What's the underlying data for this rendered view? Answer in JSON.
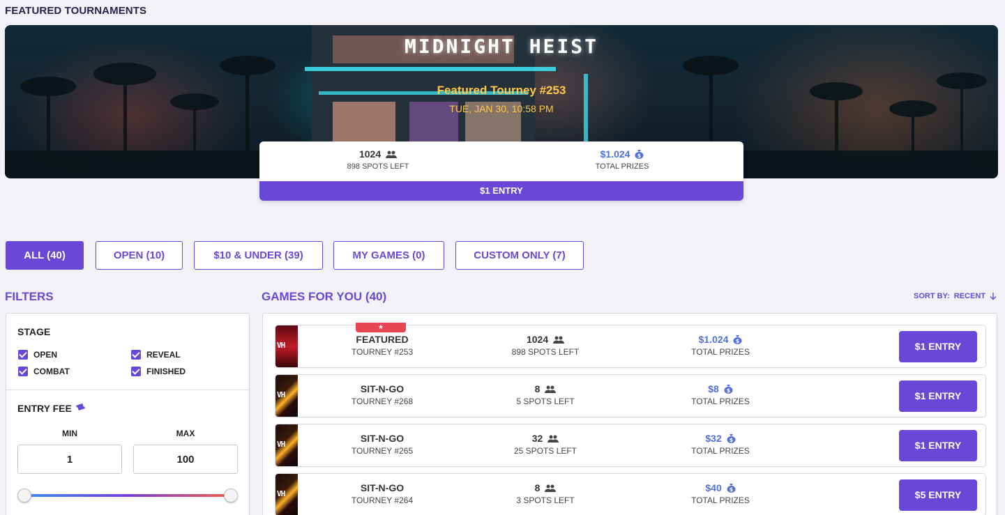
{
  "section_title": "FEATURED TOURNAMENTS",
  "banner": {
    "logo_text": "MIDNIGHT HEIST",
    "title": "Featured Tourney #253",
    "date": "TUE, JAN 30, 10:58 PM",
    "players": "1024",
    "spots_left": "898 SPOTS LEFT",
    "prize": "$1.024",
    "prize_label": "TOTAL PRIZES",
    "entry": "$1 ENTRY"
  },
  "tabs": [
    {
      "label": "ALL (40)",
      "active": true
    },
    {
      "label": "OPEN (10)"
    },
    {
      "label": "$10 & UNDER (39)"
    },
    {
      "label": "MY GAMES (0)"
    },
    {
      "label": "CUSTOM ONLY (7)"
    }
  ],
  "filters": {
    "title": "FILTERS",
    "stage_title": "STAGE",
    "stages": [
      "OPEN",
      "REVEAL",
      "COMBAT",
      "FINISHED"
    ],
    "fee_title": "ENTRY FEE",
    "min_label": "MIN",
    "max_label": "MAX",
    "min_value": "1",
    "max_value": "100"
  },
  "games": {
    "title": "GAMES FOR YOU (40)",
    "sort_label": "SORT BY:",
    "sort_value": "RECENT",
    "thumb_text": "VH",
    "rows": [
      {
        "type": "FEATURED",
        "tourney": "TOURNEY #253",
        "players": "1024",
        "spots": "898 SPOTS LEFT",
        "prize": "$1.024",
        "prize_label": "TOTAL PRIZES",
        "entry": "$1 ENTRY",
        "featured": true
      },
      {
        "type": "SIT-N-GO",
        "tourney": "TOURNEY #268",
        "players": "8",
        "spots": "5 SPOTS LEFT",
        "prize": "$8",
        "prize_label": "TOTAL PRIZES",
        "entry": "$1 ENTRY"
      },
      {
        "type": "SIT-N-GO",
        "tourney": "TOURNEY #265",
        "players": "32",
        "spots": "25 SPOTS LEFT",
        "prize": "$32",
        "prize_label": "TOTAL PRIZES",
        "entry": "$1 ENTRY"
      },
      {
        "type": "SIT-N-GO",
        "tourney": "TOURNEY #264",
        "players": "8",
        "spots": "3 SPOTS LEFT",
        "prize": "$40",
        "prize_label": "TOTAL PRIZES",
        "entry": "$5 ENTRY"
      }
    ]
  },
  "colors": {
    "accent": "#6a48d7",
    "prize_blue": "#4f6fdc",
    "banner_gold": "#ffc94a",
    "featured_red": "#e64553"
  },
  "icons": {
    "players": "users-icon",
    "prize": "money-bag-icon",
    "fee": "ticket-icon",
    "sort": "arrow-down-icon",
    "featured": "star-icon"
  }
}
